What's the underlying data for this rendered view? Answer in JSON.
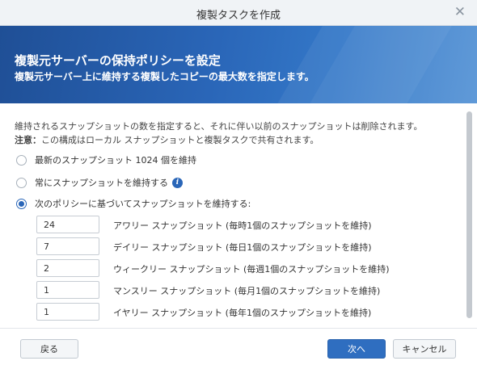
{
  "window": {
    "title": "複製タスクを作成",
    "close_glyph": "✕"
  },
  "banner": {
    "title": "複製元サーバーの保持ポリシーを設定",
    "subtitle": "複製元サーバー上に維持する複製したコピーの最大数を指定します。"
  },
  "description": {
    "line1": "維持されるスナップショットの数を指定すると、それに伴い以前のスナップショットは削除されます。",
    "note_prefix": "注意：",
    "note_text": "この構成はローカル スナップショットと複製タスクで共有されます。"
  },
  "options": {
    "latest": {
      "label": "最新のスナップショット 1024 個を維持",
      "selected": false
    },
    "always": {
      "label": "常にスナップショットを維持する",
      "selected": false,
      "info_glyph": "i"
    },
    "policy": {
      "label": "次のポリシーに基づいてスナップショットを維持する:",
      "selected": true
    }
  },
  "policy_fields": [
    {
      "value": "24",
      "label": "アワリー スナップショット (毎時1個のスナップショットを維持)"
    },
    {
      "value": "7",
      "label": "デイリー スナップショット (毎日1個のスナップショットを維持)"
    },
    {
      "value": "2",
      "label": "ウィークリー スナップショット (毎週1個のスナップショットを維持)"
    },
    {
      "value": "1",
      "label": "マンスリー スナップショット (毎月1個のスナップショットを維持)"
    },
    {
      "value": "1",
      "label": "イヤリー スナップショット (毎年1個のスナップショットを維持)"
    }
  ],
  "footer": {
    "back": "戻る",
    "next": "次へ",
    "cancel": "キャンセル"
  },
  "colors": {
    "accent": "#2a66b8",
    "banner_dark": "#1f4f96",
    "banner_light": "#5694d6"
  }
}
